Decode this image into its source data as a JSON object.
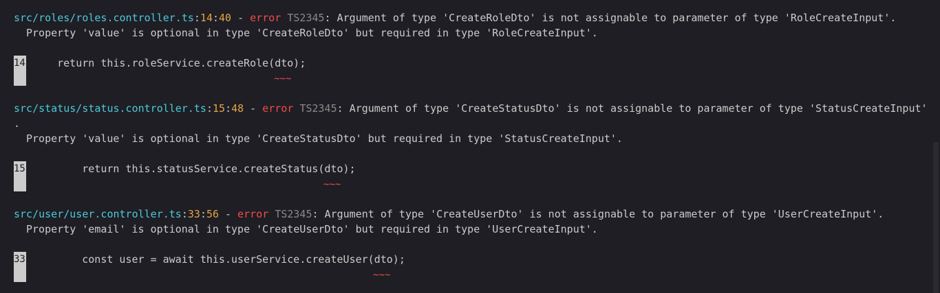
{
  "errors": [
    {
      "path": "src/roles/roles.controller.ts",
      "line": "14",
      "col": "40",
      "severity": "error",
      "code": "TS2345",
      "message": "Argument of type 'CreateRoleDto' is not assignable to parameter of type 'RoleCreateInput'.",
      "detail": "Property 'value' is optional in type 'CreateRoleDto' but required in type 'RoleCreateInput'.",
      "gutter": "14",
      "source": "    return this.roleService.createRole(dto);",
      "squiggle": "~~~"
    },
    {
      "path": "src/status/status.controller.ts",
      "line": "15",
      "col": "48",
      "severity": "error",
      "code": "TS2345",
      "message": "Argument of type 'CreateStatusDto' is not assignable to parameter of type 'StatusCreateInput'",
      "message_wrap": ".",
      "detail": "Property 'value' is optional in type 'CreateStatusDto' but required in type 'StatusCreateInput'.",
      "gutter": "15",
      "source": "        return this.statusService.createStatus(dto);",
      "squiggle": "~~~"
    },
    {
      "path": "src/user/user.controller.ts",
      "line": "33",
      "col": "56",
      "severity": "error",
      "code": "TS2345",
      "message": "Argument of type 'CreateUserDto' is not assignable to parameter of type 'UserCreateInput'.",
      "detail": "Property 'email' is optional in type 'CreateUserDto' but required in type 'UserCreateInput'.",
      "gutter": "33",
      "source": "        const user = await this.userService.createUser(dto);",
      "squiggle": "~~~"
    }
  ],
  "colors": {
    "background": "#1e1e24",
    "path": "#4ec9d8",
    "location": "#e5a445",
    "error": "#f14c4c",
    "code": "#8a8a8a",
    "text": "#cccccc"
  }
}
